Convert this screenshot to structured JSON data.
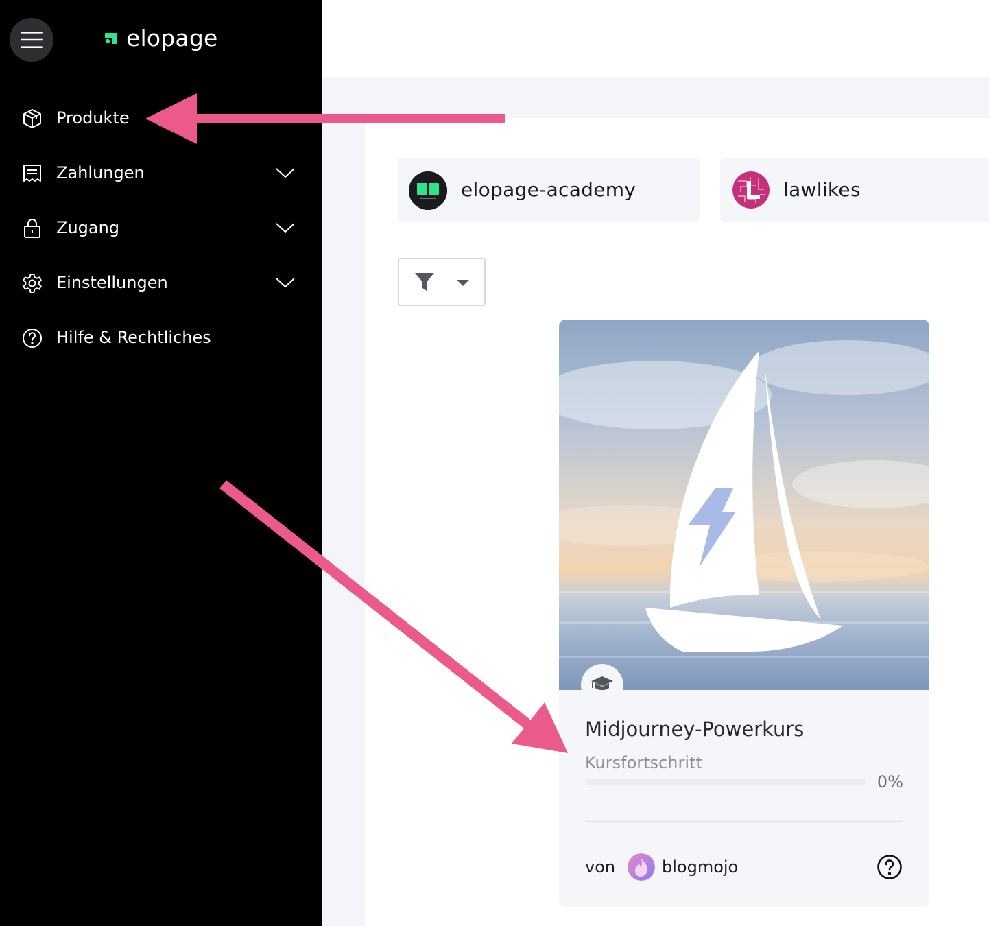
{
  "brand": {
    "name": "elopage",
    "accent": "#2ee38a"
  },
  "sidebar": {
    "items": [
      {
        "label": "Produkte",
        "icon": "box-icon",
        "expandable": false
      },
      {
        "label": "Zahlungen",
        "icon": "receipt-icon",
        "expandable": true
      },
      {
        "label": "Zugang",
        "icon": "lock-icon",
        "expandable": true
      },
      {
        "label": "Einstellungen",
        "icon": "gear-icon",
        "expandable": true
      },
      {
        "label": "Hilfe & Rechtliches",
        "icon": "help-circle-icon",
        "expandable": false
      }
    ]
  },
  "shops": [
    {
      "name": "elopage-academy",
      "avatar_color": "#1a1b1f"
    },
    {
      "name": "lawlikes",
      "avatar_color": "#c2317a"
    }
  ],
  "filter": {
    "icon": "filter-icon"
  },
  "course_card": {
    "title": "Midjourney-Powerkurs",
    "progress_label": "Kursfortschritt",
    "progress_value": "0%",
    "progress_fraction": 0,
    "by_label": "von",
    "author": "blogmojo"
  },
  "annotation_color": "#ec5a8c"
}
